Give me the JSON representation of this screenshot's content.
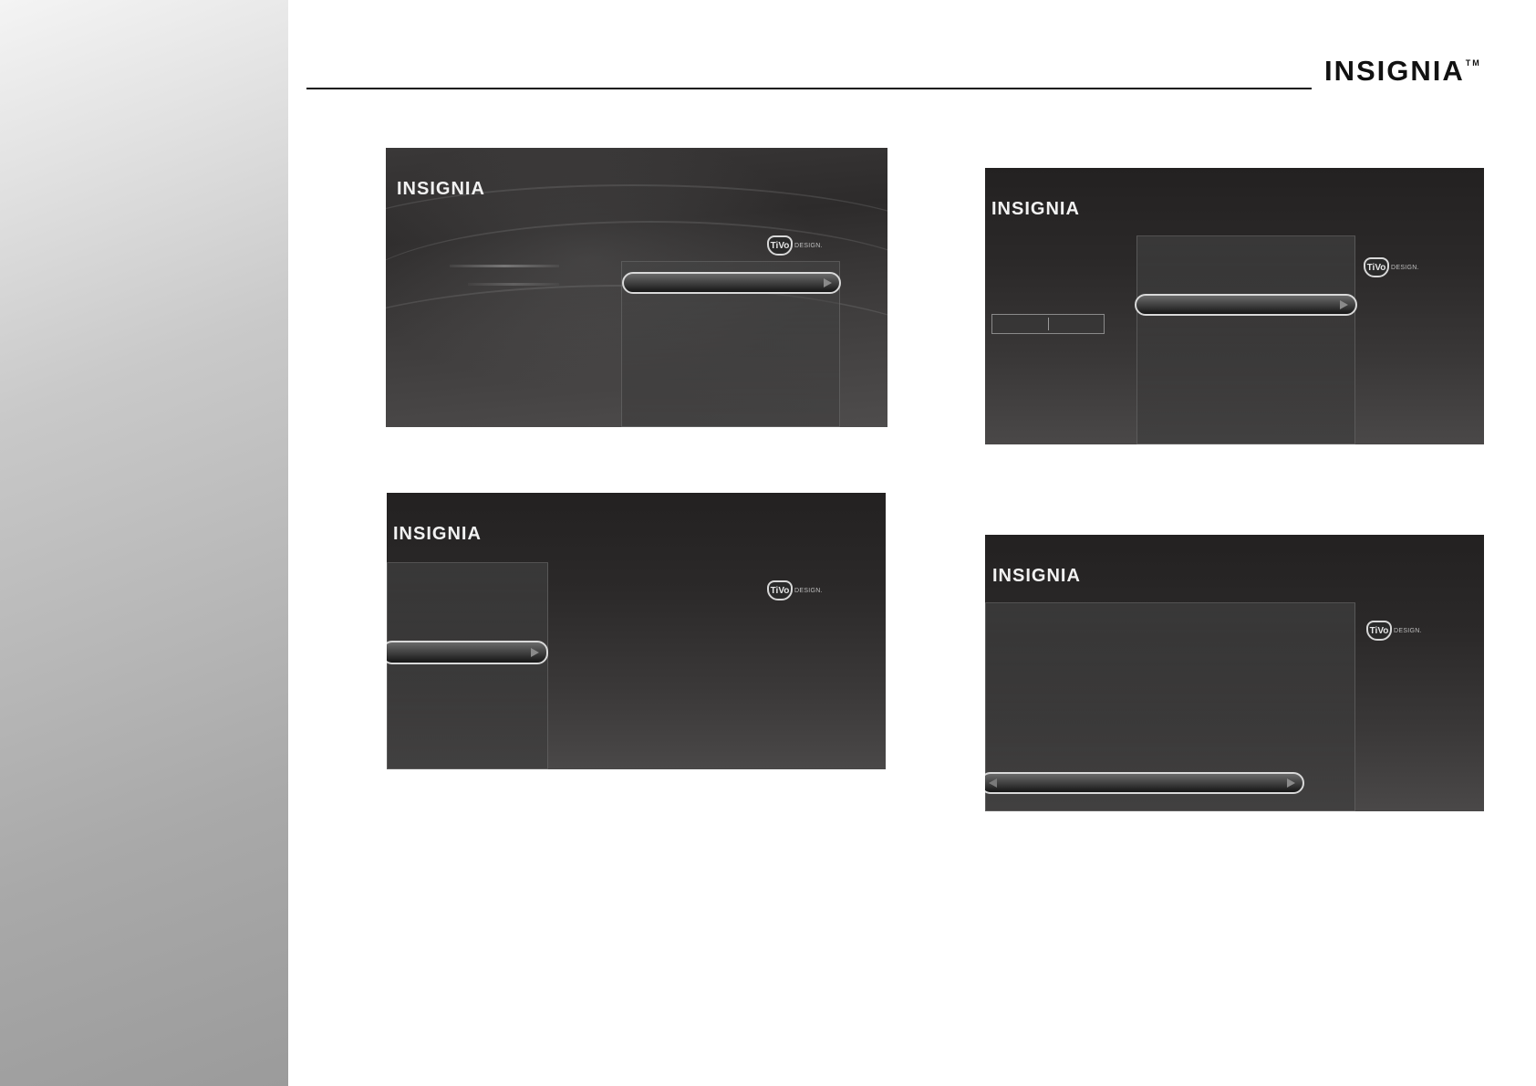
{
  "header": {
    "brand": "INSIGNIA",
    "trademark": "TM"
  },
  "screens": [
    {
      "id": "screen-1",
      "logo": "INSIGNIA",
      "tivo_badge": "TiVo",
      "tivo_text": "DESIGN."
    },
    {
      "id": "screen-2",
      "logo": "INSIGNIA",
      "tivo_badge": "TiVo",
      "tivo_text": "DESIGN."
    },
    {
      "id": "screen-3",
      "logo": "INSIGNIA",
      "tivo_badge": "TiVo",
      "tivo_text": "DESIGN."
    },
    {
      "id": "screen-4",
      "logo": "INSIGNIA",
      "tivo_badge": "TiVo",
      "tivo_text": "DESIGN."
    }
  ],
  "icons": [
    "tivo-icon",
    "arrow-right-icon",
    "arrow-left-icon"
  ]
}
